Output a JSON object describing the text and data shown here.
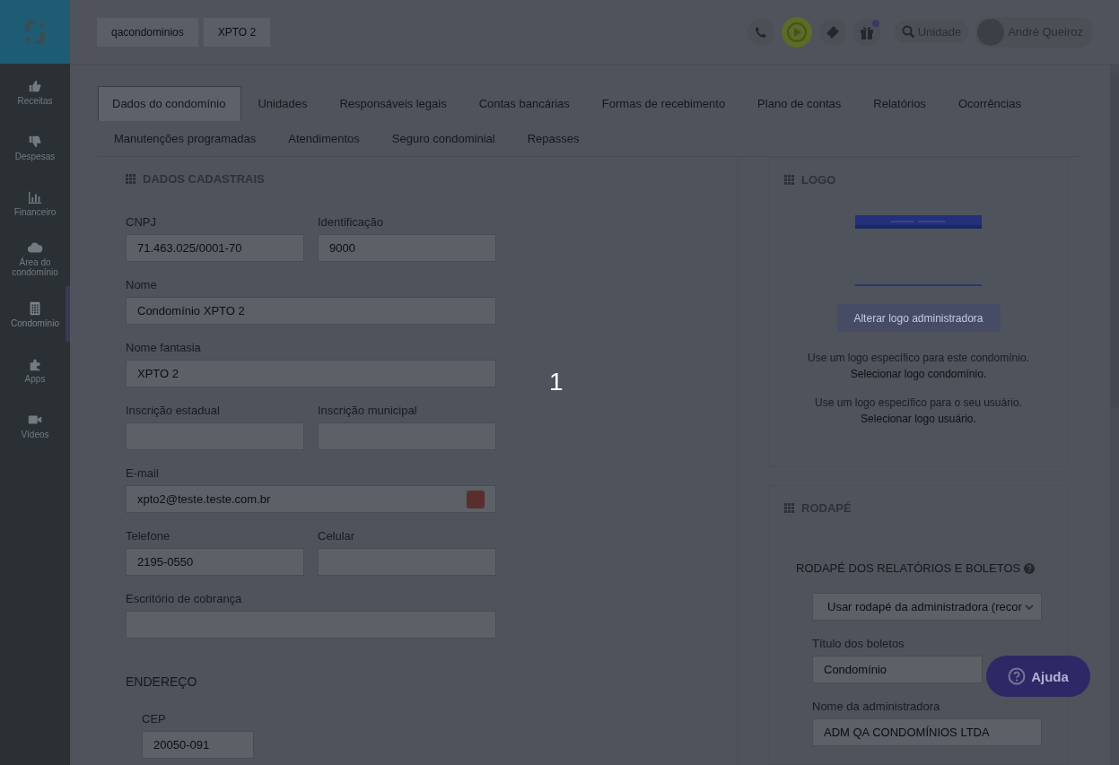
{
  "sidebar": {
    "items": [
      {
        "label": "Receitas",
        "selected": false
      },
      {
        "label": "Despesas",
        "selected": false
      },
      {
        "label": "Financeiro",
        "selected": false
      },
      {
        "label": "Área do condomínio",
        "selected": false
      },
      {
        "label": "Condomínio",
        "selected": true
      },
      {
        "label": "Apps",
        "selected": false
      },
      {
        "label": "Vídeos",
        "selected": false
      }
    ]
  },
  "breadcrumbs": [
    "qacondominios",
    "XPTO 2"
  ],
  "header": {
    "gift_notification": true,
    "search_label": "Unidade",
    "user_name": "André Queiroz"
  },
  "tabs": [
    {
      "label": "Dados do condomínio",
      "selected": true
    },
    {
      "label": "Unidades",
      "selected": false
    },
    {
      "label": "Responsáveis legais",
      "selected": false
    },
    {
      "label": "Contas bancárias",
      "selected": false
    },
    {
      "label": "Formas de recebimento",
      "selected": false
    },
    {
      "label": "Plano de contas",
      "selected": false
    },
    {
      "label": "Relatórios",
      "selected": false
    },
    {
      "label": "Ocorrências",
      "selected": false
    },
    {
      "label": "Manutenções programadas",
      "selected": false
    },
    {
      "label": "Atendimentos",
      "selected": false
    },
    {
      "label": "Seguro condominial",
      "selected": false
    },
    {
      "label": "Repasses",
      "selected": false
    }
  ],
  "dados_cadastrais": {
    "title": "DADOS CADASTRAIS",
    "rows": [
      [
        {
          "label": "CNPJ",
          "value": "71.463.025/0001-70",
          "kind": "text"
        },
        {
          "label": "Identificação",
          "value": "9000",
          "kind": "text"
        }
      ],
      [
        {
          "label": "Nome",
          "value": "Condomínio XPTO 2",
          "kind": "text"
        }
      ],
      [
        {
          "label": "Nome fantasia",
          "value": "XPTO 2",
          "kind": "text"
        }
      ],
      [
        {
          "label": "Inscrição estadual",
          "kind": "text"
        },
        {
          "label": "Inscrição municipal",
          "kind": "text"
        }
      ],
      [
        {
          "label": "E-mail",
          "value": "xpto2@teste.teste.com.br",
          "kind": "action"
        }
      ],
      [
        {
          "label": "Telefone",
          "value": "2195-0550",
          "kind": "text"
        },
        {
          "label": "Celular",
          "kind": "text"
        }
      ],
      [
        {
          "label": "Escritório de cobrança",
          "kind": "text"
        }
      ]
    ],
    "endereco": {
      "title": "ENDEREÇO",
      "fields": [
        {
          "label": "CEP",
          "value": "20050-091"
        }
      ]
    }
  },
  "logo": {
    "title": "LOGO",
    "button": "Alterar logo administradora",
    "options": [
      {
        "text": "Use um logo específico para este condomínio.",
        "link": "Selecionar logo condomínio."
      },
      {
        "text": "Use um logo específico para o seu usuário.",
        "link": "Selecionar logo usuário."
      }
    ]
  },
  "rodape": {
    "title": "RODAPÉ",
    "subtitle": "RODAPÉ DOS RELATÓRIOS E BOLETOS",
    "select": "Usar rodapé da administradora (recor",
    "fields": [
      {
        "label": "Título dos boletos",
        "value": "Condomínio"
      },
      {
        "label": "Nome da administradora",
        "value": "ADM QA CONDOMÍNIOS LTDA"
      }
    ]
  },
  "help_button": "Ajuda",
  "overlay_step": "1"
}
